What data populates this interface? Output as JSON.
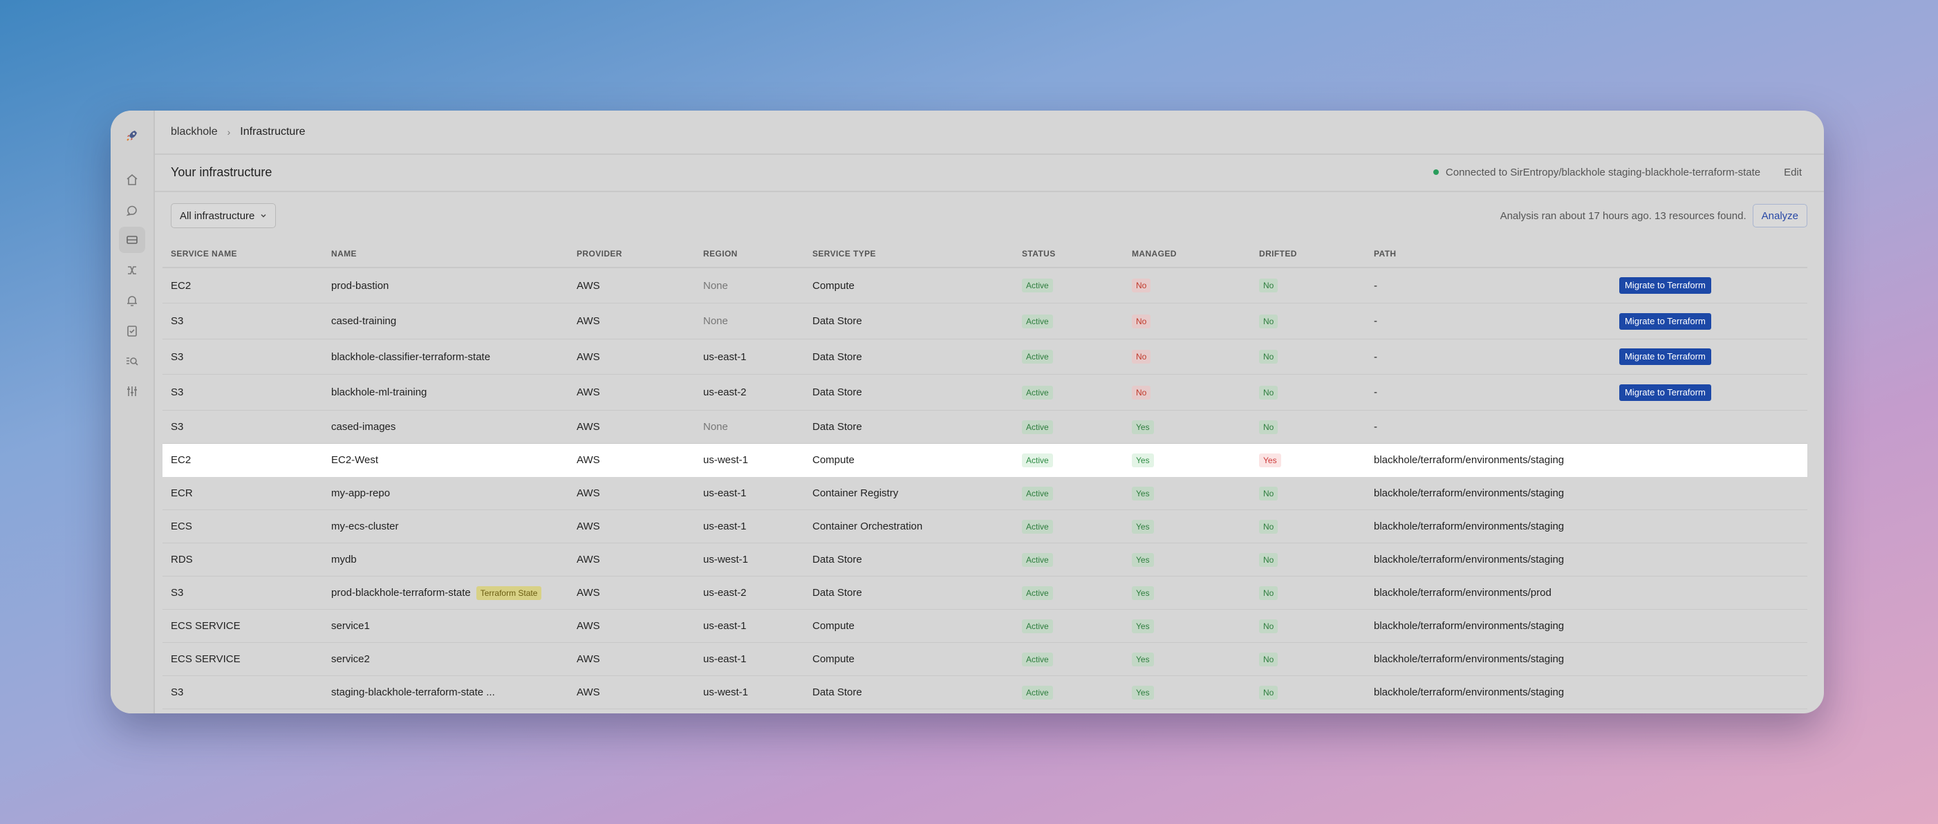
{
  "breadcrumb": {
    "root": "blackhole",
    "current": "Infrastructure"
  },
  "header": {
    "title": "Your infrastructure",
    "connection_text": "Connected to SirEntropy/blackhole staging-blackhole-terraform-state",
    "edit_label": "Edit",
    "status_color": "#2a9d5c"
  },
  "filter": {
    "dropdown_label": "All infrastructure",
    "analysis_text": "Analysis ran about 17 hours ago. 13 resources found.",
    "analyze_label": "Analyze"
  },
  "sidebar": {
    "icons": [
      "rocket-icon",
      "home-icon",
      "chat-icon",
      "server-icon",
      "workflow-icon",
      "bell-icon",
      "checklist-icon",
      "search-list-icon",
      "sliders-icon"
    ]
  },
  "table": {
    "columns": {
      "service_name": "SERVICE NAME",
      "name": "NAME",
      "provider": "PROVIDER",
      "region": "REGION",
      "service_type": "SERVICE TYPE",
      "status": "STATUS",
      "managed": "MANAGED",
      "drifted": "DRIFTED",
      "path": "PATH"
    },
    "migrate_label": "Migrate to Terraform",
    "rows": [
      {
        "service": "EC2",
        "name": "prod-bastion",
        "tag": "",
        "provider": "AWS",
        "region": "None",
        "type": "Compute",
        "status": "Active",
        "managed": "No",
        "drifted": "No",
        "path": "-",
        "migrate": true,
        "highlight": false
      },
      {
        "service": "S3",
        "name": "cased-training",
        "tag": "",
        "provider": "AWS",
        "region": "None",
        "type": "Data Store",
        "status": "Active",
        "managed": "No",
        "drifted": "No",
        "path": "-",
        "migrate": true,
        "highlight": false
      },
      {
        "service": "S3",
        "name": "blackhole-classifier-terraform-state",
        "tag": "",
        "provider": "AWS",
        "region": "us-east-1",
        "type": "Data Store",
        "status": "Active",
        "managed": "No",
        "drifted": "No",
        "path": "-",
        "migrate": true,
        "highlight": false
      },
      {
        "service": "S3",
        "name": "blackhole-ml-training",
        "tag": "",
        "provider": "AWS",
        "region": "us-east-2",
        "type": "Data Store",
        "status": "Active",
        "managed": "No",
        "drifted": "No",
        "path": "-",
        "migrate": true,
        "highlight": false
      },
      {
        "service": "S3",
        "name": "cased-images",
        "tag": "",
        "provider": "AWS",
        "region": "None",
        "type": "Data Store",
        "status": "Active",
        "managed": "Yes",
        "drifted": "No",
        "path": "-",
        "migrate": false,
        "highlight": false
      },
      {
        "service": "EC2",
        "name": "EC2-West",
        "tag": "",
        "provider": "AWS",
        "region": "us-west-1",
        "type": "Compute",
        "status": "Active",
        "managed": "Yes",
        "drifted": "Yes",
        "path": "blackhole/terraform/environments/staging",
        "migrate": false,
        "highlight": true
      },
      {
        "service": "ECR",
        "name": "my-app-repo",
        "tag": "",
        "provider": "AWS",
        "region": "us-east-1",
        "type": "Container Registry",
        "status": "Active",
        "managed": "Yes",
        "drifted": "No",
        "path": "blackhole/terraform/environments/staging",
        "migrate": false,
        "highlight": false
      },
      {
        "service": "ECS",
        "name": "my-ecs-cluster",
        "tag": "",
        "provider": "AWS",
        "region": "us-east-1",
        "type": "Container Orchestration",
        "status": "Active",
        "managed": "Yes",
        "drifted": "No",
        "path": "blackhole/terraform/environments/staging",
        "migrate": false,
        "highlight": false
      },
      {
        "service": "RDS",
        "name": "mydb",
        "tag": "",
        "provider": "AWS",
        "region": "us-west-1",
        "type": "Data Store",
        "status": "Active",
        "managed": "Yes",
        "drifted": "No",
        "path": "blackhole/terraform/environments/staging",
        "migrate": false,
        "highlight": false
      },
      {
        "service": "S3",
        "name": "prod-blackhole-terraform-state",
        "tag": "Terraform State",
        "provider": "AWS",
        "region": "us-east-2",
        "type": "Data Store",
        "status": "Active",
        "managed": "Yes",
        "drifted": "No",
        "path": "blackhole/terraform/environments/prod",
        "migrate": false,
        "highlight": false
      },
      {
        "service": "ECS SERVICE",
        "name": "service1",
        "tag": "",
        "provider": "AWS",
        "region": "us-east-1",
        "type": "Compute",
        "status": "Active",
        "managed": "Yes",
        "drifted": "No",
        "path": "blackhole/terraform/environments/staging",
        "migrate": false,
        "highlight": false
      },
      {
        "service": "ECS SERVICE",
        "name": "service2",
        "tag": "",
        "provider": "AWS",
        "region": "us-east-1",
        "type": "Compute",
        "status": "Active",
        "managed": "Yes",
        "drifted": "No",
        "path": "blackhole/terraform/environments/staging",
        "migrate": false,
        "highlight": false
      },
      {
        "service": "S3",
        "name": "staging-blackhole-terraform-state ...",
        "tag": "",
        "provider": "AWS",
        "region": "us-west-1",
        "type": "Data Store",
        "status": "Active",
        "managed": "Yes",
        "drifted": "No",
        "path": "blackhole/terraform/environments/staging",
        "migrate": false,
        "highlight": false
      }
    ]
  }
}
